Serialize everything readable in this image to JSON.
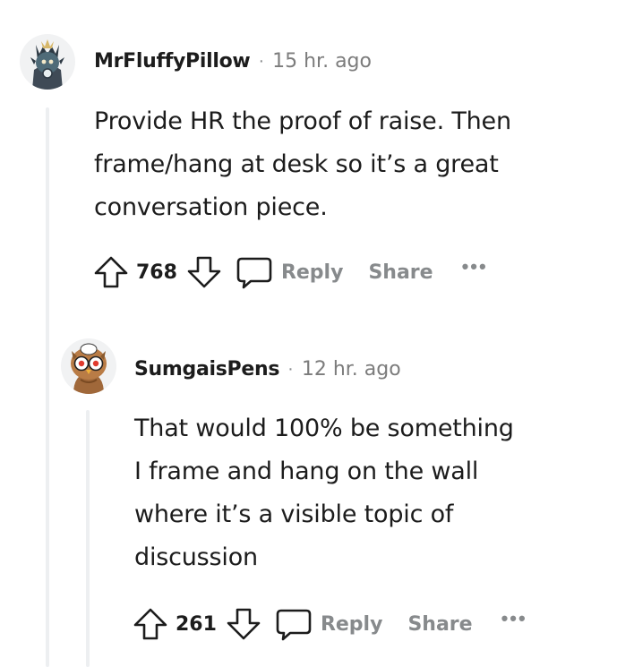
{
  "comments": [
    {
      "username": "MrFluffyPillow",
      "separator": "·",
      "time": "15 hr. ago",
      "lines": [
        "Provide HR the proof of raise. Then",
        "frame/hang at desk so it’s a great",
        "conversation piece."
      ],
      "score": "768",
      "reply_label": "Reply",
      "share_label": "Share",
      "more_label": "•••",
      "avatar_icon": "knight-avatar-icon"
    },
    {
      "username": "SumgaisPens",
      "separator": "·",
      "time": "12 hr. ago",
      "lines": [
        "That would 100% be something",
        "I frame and hang on the wall",
        "where it’s a visible topic of",
        "discussion"
      ],
      "score": "261",
      "reply_label": "Reply",
      "share_label": "Share",
      "more_label": "•••",
      "avatar_icon": "owl-avatar-icon"
    }
  ],
  "colors": {
    "text": "#1c1c1c",
    "muted": "#878a8c",
    "thread_line": "#edeff1"
  }
}
